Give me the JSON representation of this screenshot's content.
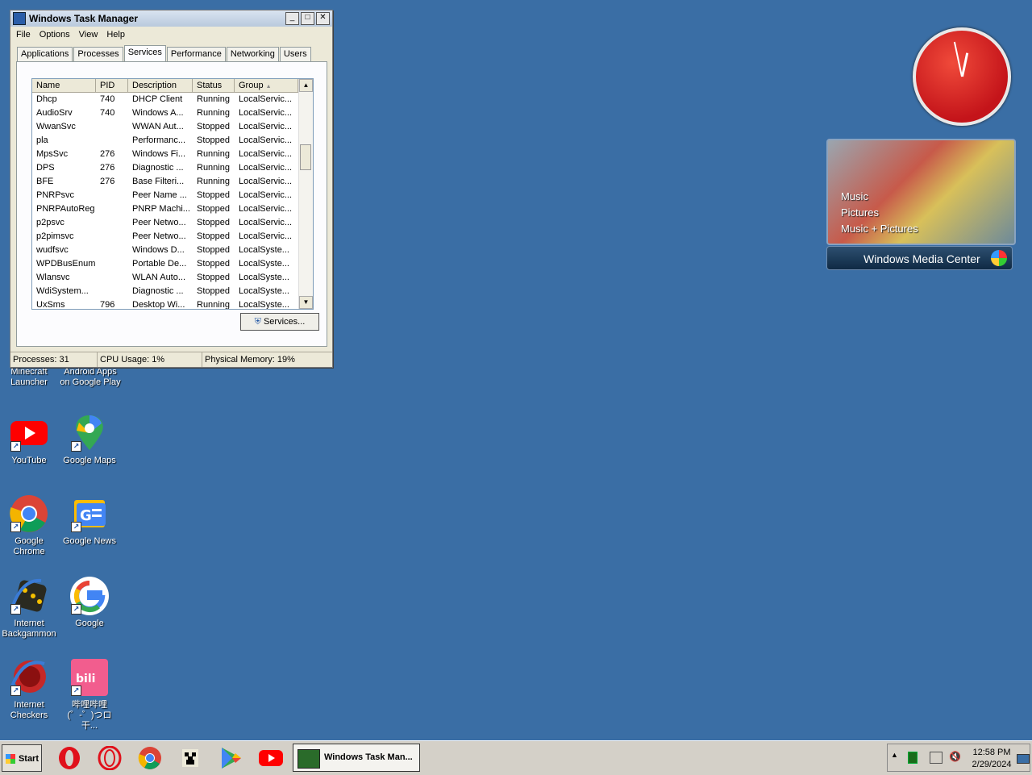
{
  "window": {
    "title": "Windows Task Manager",
    "menu": [
      "File",
      "Options",
      "View",
      "Help"
    ],
    "tabs": [
      "Applications",
      "Processes",
      "Services",
      "Performance",
      "Networking",
      "Users"
    ],
    "active_tab": "Services",
    "columns": [
      "Name",
      "PID",
      "Description",
      "Status",
      "Group"
    ],
    "rows": [
      [
        "Dhcp",
        "740",
        "DHCP Client",
        "Running",
        "LocalServic..."
      ],
      [
        "AudioSrv",
        "740",
        "Windows A...",
        "Running",
        "LocalServic..."
      ],
      [
        "WwanSvc",
        "",
        "WWAN Aut...",
        "Stopped",
        "LocalServic..."
      ],
      [
        "pla",
        "",
        "Performanc...",
        "Stopped",
        "LocalServic..."
      ],
      [
        "MpsSvc",
        "276",
        "Windows Fi...",
        "Running",
        "LocalServic..."
      ],
      [
        "DPS",
        "276",
        "Diagnostic ...",
        "Running",
        "LocalServic..."
      ],
      [
        "BFE",
        "276",
        "Base Filteri...",
        "Running",
        "LocalServic..."
      ],
      [
        "PNRPsvc",
        "",
        "Peer Name ...",
        "Stopped",
        "LocalServic..."
      ],
      [
        "PNRPAutoReg",
        "",
        "PNRP Machi...",
        "Stopped",
        "LocalServic..."
      ],
      [
        "p2psvc",
        "",
        "Peer Netwo...",
        "Stopped",
        "LocalServic..."
      ],
      [
        "p2pimsvc",
        "",
        "Peer Netwo...",
        "Stopped",
        "LocalServic..."
      ],
      [
        "wudfsvc",
        "",
        "Windows D...",
        "Stopped",
        "LocalSyste..."
      ],
      [
        "WPDBusEnum",
        "",
        "Portable De...",
        "Stopped",
        "LocalSyste..."
      ],
      [
        "Wlansvc",
        "",
        "WLAN Auto...",
        "Stopped",
        "LocalSyste..."
      ],
      [
        "WdiSystem...",
        "",
        "Diagnostic ...",
        "Stopped",
        "LocalSyste..."
      ],
      [
        "UxSms",
        "796",
        "Desktop Wi...",
        "Running",
        "LocalSyste..."
      ]
    ],
    "services_button": "Services...",
    "status": {
      "processes": "Processes: 31",
      "cpu": "CPU Usage: 1%",
      "memory": "Physical Memory: 19%"
    }
  },
  "desktop_icons": [
    {
      "label": "Minecraft Launcher",
      "icon": "minecraft-icon"
    },
    {
      "label": "Android Apps on Google Play",
      "icon": "google-play-icon"
    },
    {
      "label": "YouTube",
      "icon": "youtube-icon"
    },
    {
      "label": "Google Maps",
      "icon": "google-maps-icon"
    },
    {
      "label": "Google Chrome",
      "icon": "chrome-icon"
    },
    {
      "label": "Google News",
      "icon": "google-news-icon"
    },
    {
      "label": "Internet Backgammon",
      "icon": "backgammon-icon"
    },
    {
      "label": "Google",
      "icon": "google-icon"
    },
    {
      "label": "Internet Checkers",
      "icon": "checkers-icon"
    },
    {
      "label": "哔哩哔哩 (゜-゜)つロ 干...",
      "icon": "bilibili-icon"
    }
  ],
  "gadgets": {
    "media_center_items": [
      "Music",
      "Pictures",
      "Music + Pictures"
    ],
    "media_center_title": "Windows Media Center"
  },
  "taskbar": {
    "start_label": "Start",
    "task_label": "Windows Task Man...",
    "time": "12:58 PM",
    "date": "2/29/2024"
  }
}
